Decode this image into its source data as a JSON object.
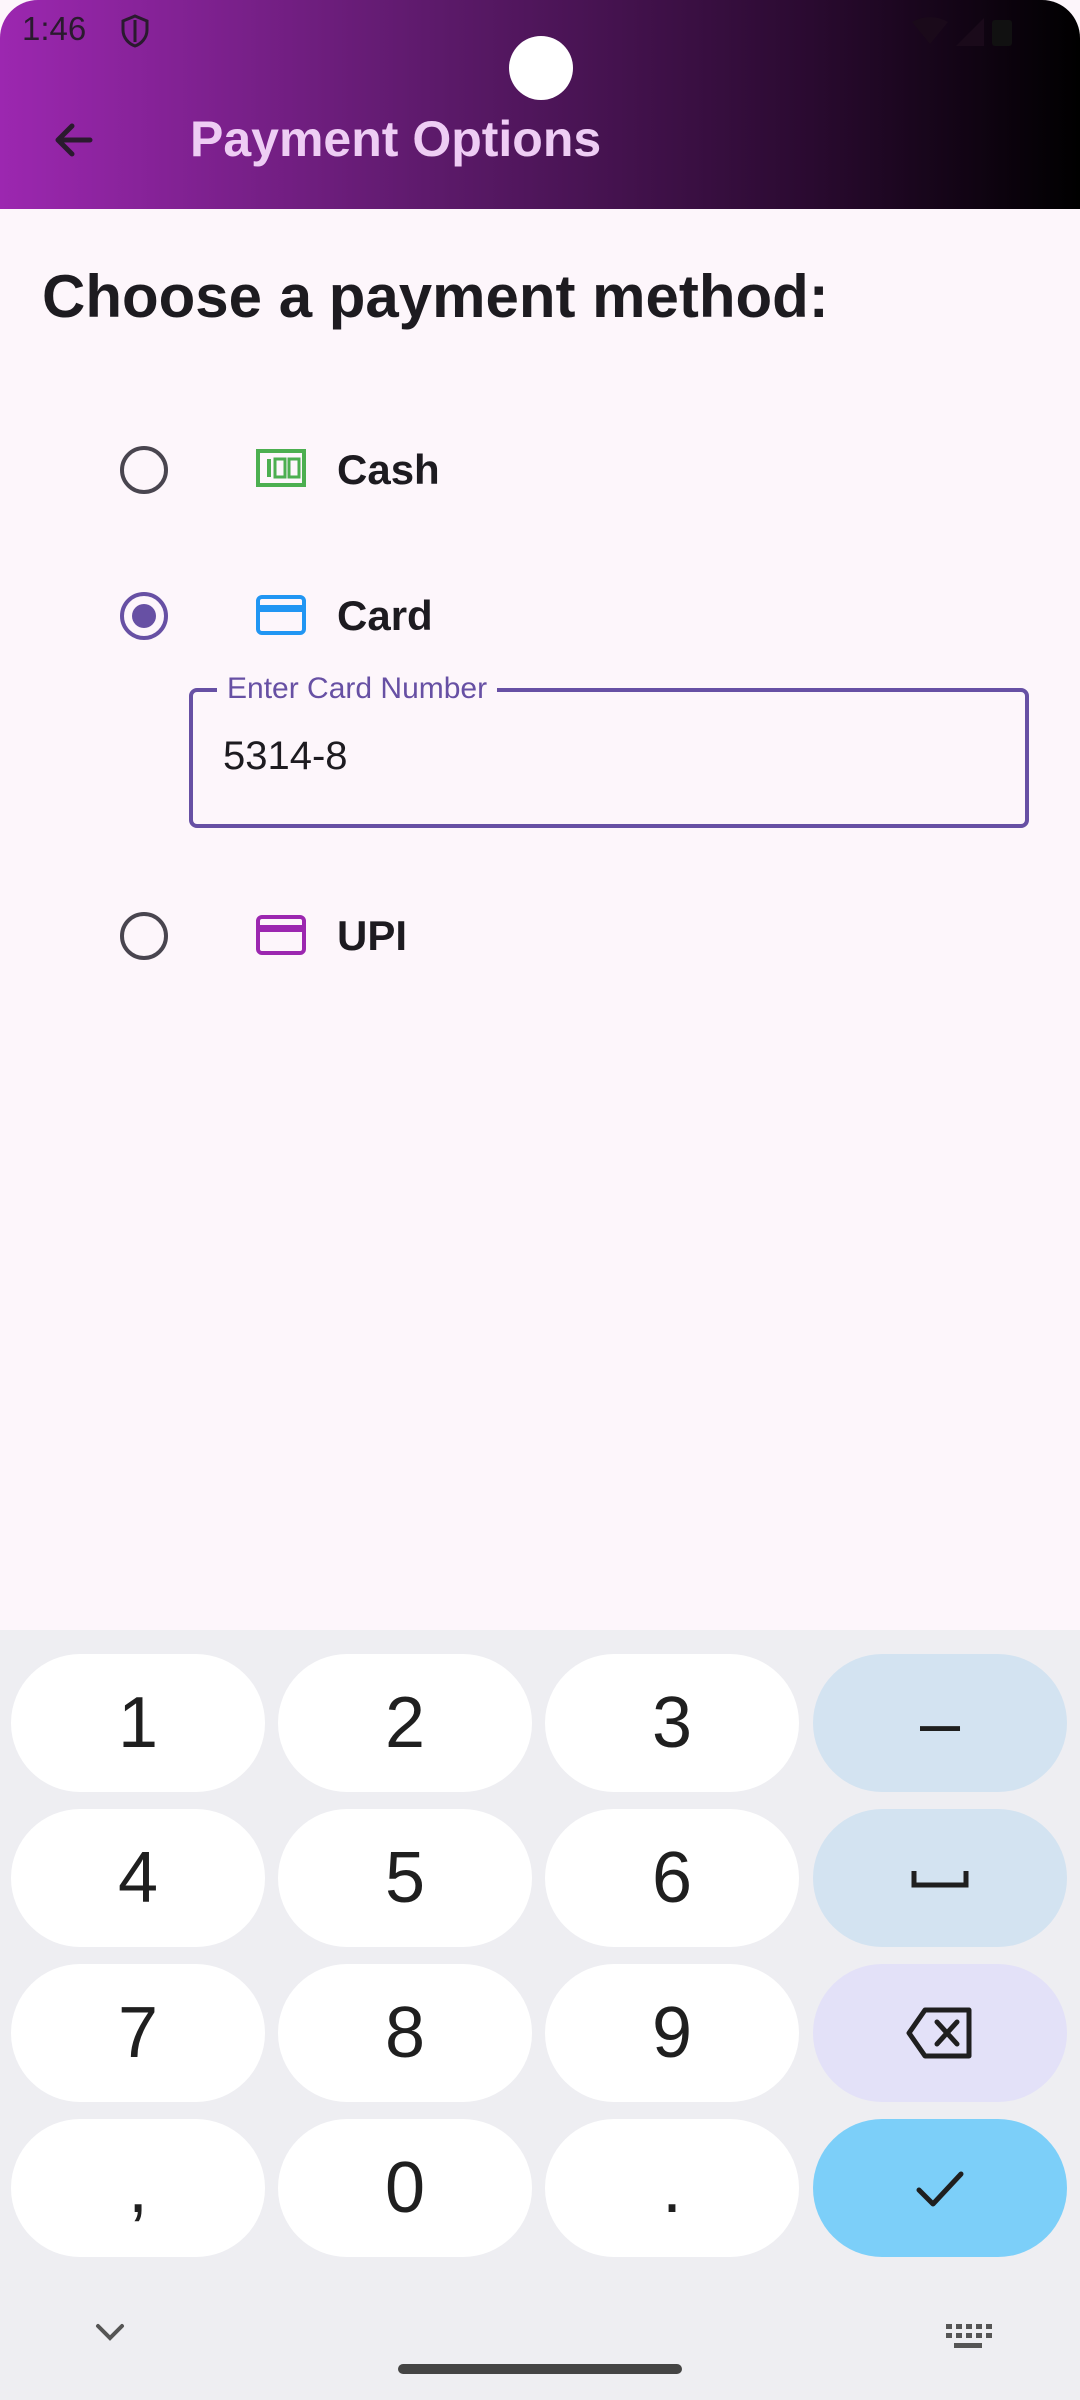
{
  "status_bar": {
    "time": "1:46"
  },
  "app_bar": {
    "title": "Payment Options",
    "gradient": [
      "#9c27b0",
      "#000000"
    ]
  },
  "page": {
    "heading": "Choose a payment method:"
  },
  "payment_methods": [
    {
      "label": "Cash",
      "icon": "cash-icon",
      "icon_color": "#4caf50",
      "selected": false
    },
    {
      "label": "Card",
      "icon": "credit-card-icon",
      "icon_color": "#2196f3",
      "selected": true
    },
    {
      "label": "UPI",
      "icon": "upi-card-icon",
      "icon_color": "#9c27b0",
      "selected": false
    }
  ],
  "card_field": {
    "label": "Enter Card Number",
    "value": "5314-8"
  },
  "keyboard": {
    "keys": [
      "1",
      "2",
      "3",
      "–",
      "4",
      "5",
      "6",
      "space",
      "7",
      "8",
      "9",
      "backspace",
      ",",
      "0",
      ".",
      "done"
    ]
  }
}
